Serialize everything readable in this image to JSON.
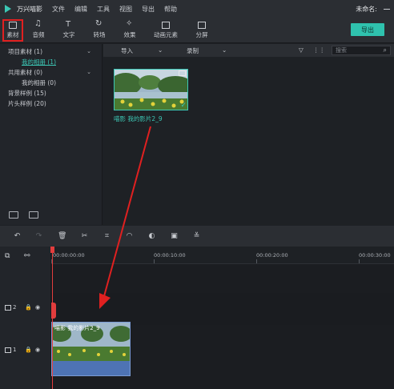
{
  "menubar": {
    "app_title": "万兴喵影",
    "items": [
      "文件",
      "编辑",
      "工具",
      "视图",
      "导出",
      "帮助"
    ],
    "project_name": "未命名:"
  },
  "toolbar": {
    "tools": [
      {
        "label": "素材",
        "icon": "folder-icon"
      },
      {
        "label": "音频",
        "icon": "music-note-icon"
      },
      {
        "label": "文字",
        "icon": "text-icon"
      },
      {
        "label": "转场",
        "icon": "transition-icon"
      },
      {
        "label": "效果",
        "icon": "effects-icon"
      },
      {
        "label": "动画元素",
        "icon": "elements-icon"
      },
      {
        "label": "分屏",
        "icon": "split-screen-icon"
      }
    ],
    "export_label": "导出"
  },
  "left_panel": {
    "items": [
      {
        "label": "项目素材 (1)",
        "expandable": true
      },
      {
        "label": "我的相册 (1)",
        "selected": true
      },
      {
        "label": "共用素材 (0)",
        "expandable": true
      },
      {
        "label": "我的相册 (0)"
      },
      {
        "label": "背景样例 (15)"
      },
      {
        "label": "片头样例 (20)"
      }
    ]
  },
  "browser": {
    "import_label": "导入",
    "record_label": "录制",
    "search_placeholder": "搜索",
    "clip_caption": "喵影 我的影片2_9"
  },
  "timeline": {
    "timecodes": [
      "00:00:00:00",
      "00:00:10:00",
      "00:00:20:00",
      "00:00:30:00"
    ],
    "tracks": [
      {
        "number": "2"
      },
      {
        "number": "1"
      }
    ],
    "clip_title": "喵影 我的影片2_9"
  },
  "colors": {
    "accent": "#3cc7b5",
    "highlight_box": "#e02020",
    "clip_blue": "#3b5c9a",
    "playhead": "#e23d3d"
  }
}
